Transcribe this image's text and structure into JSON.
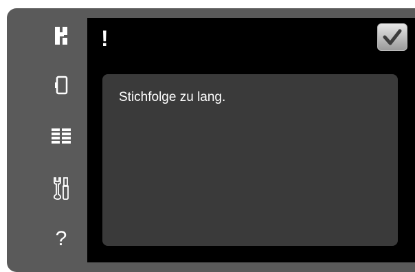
{
  "screen": {
    "alert_glyph": "!",
    "message": "Stichfolge zu lang."
  },
  "sidebar": {
    "items": [
      {
        "icon": "presser-foot-icon"
      },
      {
        "icon": "hoop-icon"
      },
      {
        "icon": "stitch-menu-icon"
      },
      {
        "icon": "tools-icon"
      },
      {
        "icon": "help-icon",
        "glyph": "?"
      }
    ]
  },
  "confirm": {
    "icon": "checkmark-icon"
  },
  "colors": {
    "frame": "#5a5a5a",
    "screen_bg": "#000000",
    "message_bg": "#3a3a3a",
    "text": "#ffffff"
  }
}
